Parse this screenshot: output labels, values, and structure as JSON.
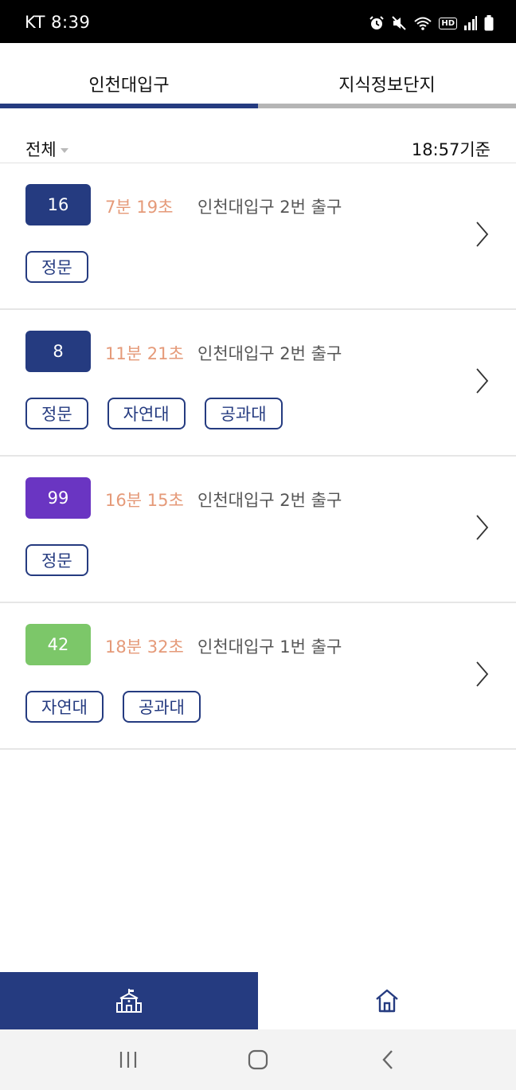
{
  "status_bar": {
    "carrier_time": "KT 8:39",
    "hd_label": "HD"
  },
  "tabs": [
    {
      "label": "인천대입구",
      "active": true
    },
    {
      "label": "지식정보단지",
      "active": false
    }
  ],
  "filter": {
    "selected": "전체",
    "base_time": "18:57기준"
  },
  "colors": {
    "accent": "#253b80",
    "arrival": "#e59a79",
    "bus_16": "#253b80",
    "bus_8": "#253b80",
    "bus_99": "#6a35c2",
    "bus_42": "#7cc769"
  },
  "buses": [
    {
      "number": "16",
      "arrival": "7분 19초",
      "stop": "인천대입구 2번 출구",
      "tags": [
        "정문"
      ]
    },
    {
      "number": "8",
      "arrival": "11분 21초",
      "stop": "인천대입구 2번 출구",
      "tags": [
        "정문",
        "자연대",
        "공과대"
      ]
    },
    {
      "number": "99",
      "arrival": "16분 15초",
      "stop": "인천대입구 2번 출구",
      "tags": [
        "정문"
      ]
    },
    {
      "number": "42",
      "arrival": "18분 32초",
      "stop": "인천대입구 1번 출구",
      "tags": [
        "자연대",
        "공과대"
      ]
    }
  ],
  "bottom_nav": [
    {
      "icon": "school-icon",
      "active": true
    },
    {
      "icon": "home-icon",
      "active": false
    }
  ],
  "system_nav": [
    "recent-apps-icon",
    "home-button-icon",
    "back-icon"
  ]
}
